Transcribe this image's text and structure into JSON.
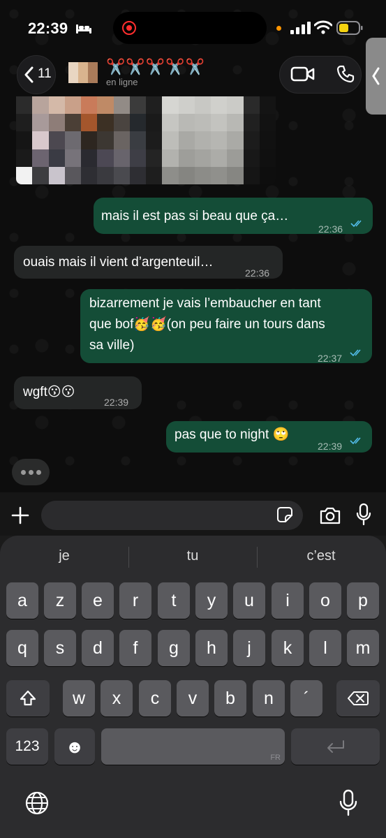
{
  "status_bar": {
    "time": "22:39"
  },
  "header": {
    "back_count": "11",
    "contact_name": "✂️✂️✂️✂️✂️",
    "contact_status": "en ligne"
  },
  "messages": [
    {
      "direction": "out",
      "text": "mais il est pas si beau que ça…",
      "time": "22:36",
      "read": true
    },
    {
      "direction": "in",
      "text": "ouais mais il vient d’argenteuil…",
      "time": "22:36"
    },
    {
      "direction": "out",
      "text": "bizarrement je vais l’embaucher en tant\nque bof🥳🥳(on peu faire un tours dans\nsa ville)",
      "time": "22:37",
      "read": true
    },
    {
      "direction": "in",
      "text": "wgft😗😗",
      "time": "22:39"
    },
    {
      "direction": "out",
      "text": "pas que to night 🙄",
      "time": "22:39",
      "read": true
    }
  ],
  "input": {
    "placeholder": ""
  },
  "keyboard": {
    "suggestions": [
      "je",
      "tu",
      "c’est"
    ],
    "row1": [
      "a",
      "z",
      "e",
      "r",
      "t",
      "y",
      "u",
      "i",
      "o",
      "p"
    ],
    "row2": [
      "q",
      "s",
      "d",
      "f",
      "g",
      "h",
      "j",
      "k",
      "l",
      "m"
    ],
    "row3": [
      "w",
      "x",
      "c",
      "v",
      "b",
      "n",
      "´"
    ],
    "numbers_key": "123",
    "emoji_key": "☻",
    "space_language": "FR"
  },
  "colors": {
    "outgoing_bubble": "#144d37",
    "incoming_bubble": "#242626",
    "read_ticks": "#53bdeb",
    "recording": "#ff2e2e",
    "battery": "#f5d310"
  },
  "icons": [
    "bed-icon",
    "signal-icon",
    "wifi-icon",
    "battery-icon",
    "back-chevron-icon",
    "video-call-icon",
    "phone-call-icon",
    "plus-icon",
    "sticker-icon",
    "camera-icon",
    "microphone-icon",
    "shift-icon",
    "backspace-icon",
    "return-icon",
    "globe-icon"
  ]
}
